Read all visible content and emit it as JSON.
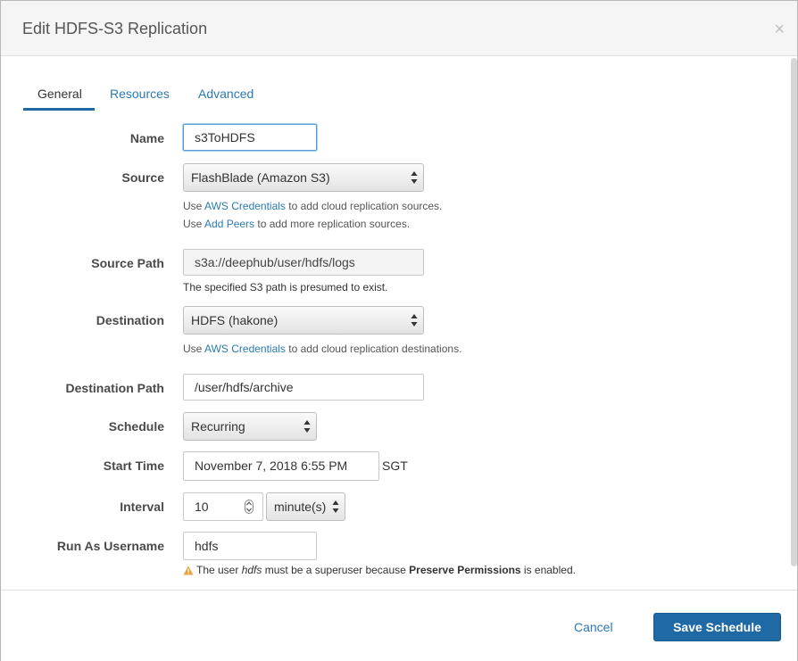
{
  "dialog": {
    "title": "Edit HDFS-S3 Replication",
    "close_label": "×"
  },
  "tabs": [
    {
      "label": "General",
      "active": true
    },
    {
      "label": "Resources",
      "active": false
    },
    {
      "label": "Advanced",
      "active": false
    }
  ],
  "form": {
    "name": {
      "label": "Name",
      "value": "s3ToHDFS"
    },
    "source": {
      "label": "Source",
      "value": "FlashBlade (Amazon S3)",
      "help1_prefix": "Use ",
      "help1_link": "AWS Credentials",
      "help1_suffix": " to add cloud replication sources.",
      "help2_prefix": "Use ",
      "help2_link": "Add Peers",
      "help2_suffix": " to add more replication sources."
    },
    "source_path": {
      "label": "Source Path",
      "value": "s3a://deephub/user/hdfs/logs",
      "help": "The specified S3 path is presumed to exist."
    },
    "destination": {
      "label": "Destination",
      "value": "HDFS (hakone)",
      "help_prefix": "Use ",
      "help_link": "AWS Credentials",
      "help_suffix": " to add cloud replication destinations."
    },
    "destination_path": {
      "label": "Destination Path",
      "value": "/user/hdfs/archive"
    },
    "schedule": {
      "label": "Schedule",
      "value": "Recurring"
    },
    "start_time": {
      "label": "Start Time",
      "value": "November 7, 2018 6:55 PM",
      "timezone": "SGT"
    },
    "interval": {
      "label": "Interval",
      "value": "10",
      "unit": "minute(s)"
    },
    "run_as": {
      "label": "Run As Username",
      "value": "hdfs",
      "warning_prefix": "The user ",
      "warning_user": "hdfs",
      "warning_middle": " must be a superuser because ",
      "warning_bold": "Preserve Permissions",
      "warning_suffix": " is enabled."
    }
  },
  "footer": {
    "cancel_label": "Cancel",
    "save_label": "Save Schedule"
  },
  "colors": {
    "accent": "#1f6aa5",
    "link": "#2b7ab0",
    "warning": "#e8a33c"
  },
  "icons": {
    "close": "close-icon",
    "warning": "warning-icon",
    "select_arrows": "select-arrows-icon",
    "stepper": "stepper-icon"
  }
}
